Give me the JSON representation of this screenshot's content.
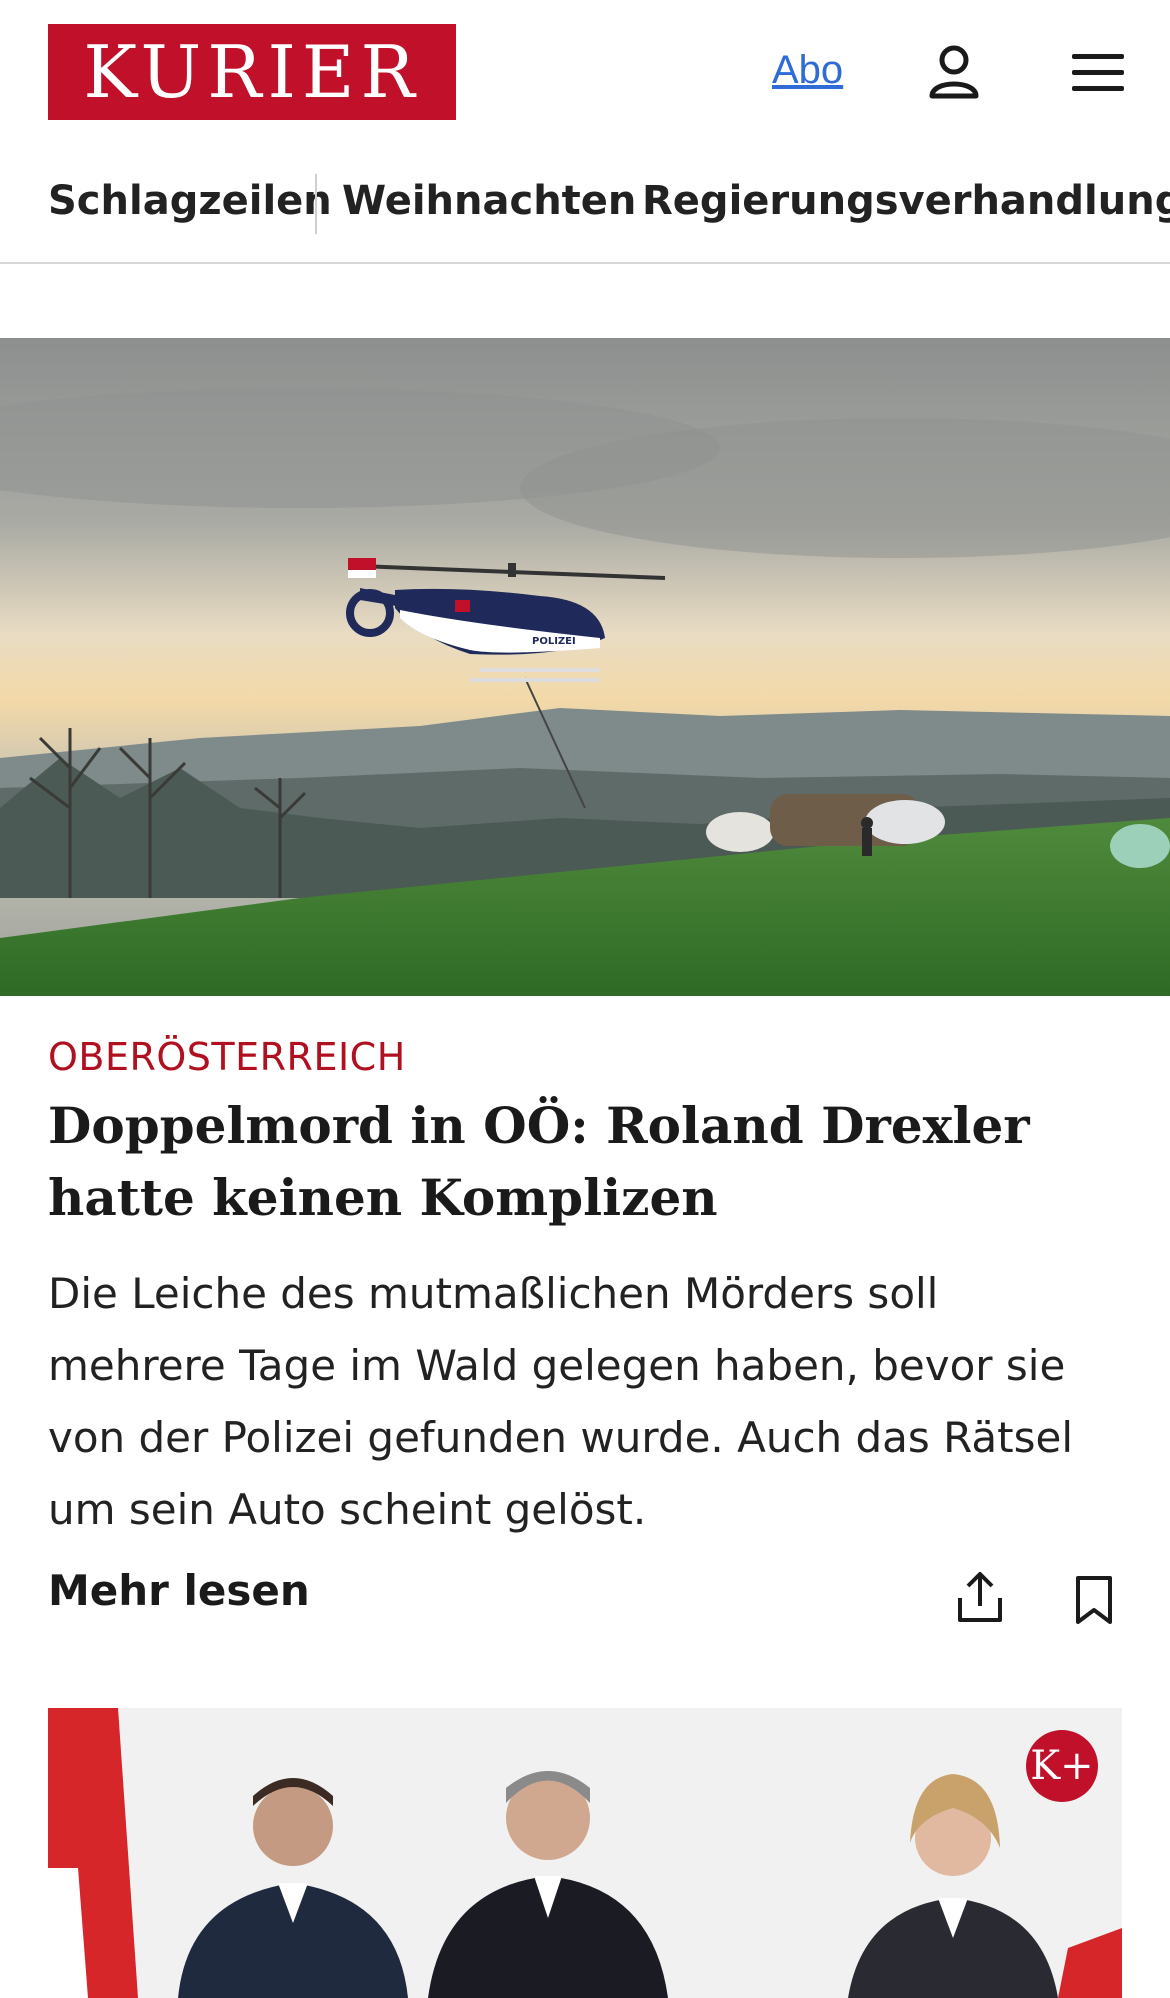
{
  "header": {
    "logo_text": "KURIER",
    "abo_label": "Abo",
    "user_icon": "user-icon",
    "menu_icon": "hamburger-menu-icon",
    "brand_color": "#c0102a"
  },
  "nav": {
    "items": [
      {
        "label": "Schlagzeilen"
      },
      {
        "label": "Weihnachten"
      },
      {
        "label": "Regierungsverhandlungen"
      }
    ]
  },
  "lead_article": {
    "category": "OBERÖSTERREICH",
    "headline": "Doppelmord in OÖ: Roland Drexler hatte keinen Komplizen",
    "teaser": "Die Leiche des mutmaßlichen Mörders soll mehrere Tage im Wald gelegen haben, bevor sie von der Polizei gefunden wurde. Auch das Rätsel um sein Auto scheint gelöst.",
    "more_label": "Mehr lesen",
    "share_icon": "share-icon",
    "bookmark_icon": "bookmark-icon",
    "helicopter_label": "POLIZEI"
  },
  "second_article": {
    "badge": "K+"
  }
}
